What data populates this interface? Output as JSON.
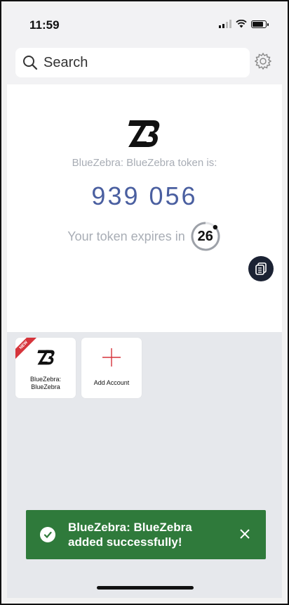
{
  "status_bar": {
    "time": "11:59",
    "icons": [
      "signal-icon",
      "wifi-icon",
      "battery-icon"
    ]
  },
  "search": {
    "placeholder": "Search",
    "icon": "search-icon",
    "settings_icon": "gear-icon"
  },
  "token": {
    "logo_icon": "bluezebra-logo",
    "label": "BlueZebra: BlueZebra token is:",
    "code": "939 056",
    "expires_text": "Your token expires in",
    "seconds_remaining": "26",
    "seconds_remaining_fraction": 0.87,
    "copy_icon": "copy-icon",
    "code_color": "#4a5fa0"
  },
  "accounts": [
    {
      "name": "BlueZebra:\nBlueZebra",
      "line1": "BlueZebra:",
      "line2": "BlueZebra",
      "badge": "NEW",
      "icon": "bluezebra-logo"
    }
  ],
  "add_account": {
    "label": "Add Account",
    "icon": "plus-icon",
    "icon_color": "#d6343b"
  },
  "toast": {
    "line1": "BlueZebra: BlueZebra",
    "line2": "added successfully!",
    "icon": "check-circle-icon",
    "close_icon": "close-icon",
    "color": "#2f7a3b"
  }
}
